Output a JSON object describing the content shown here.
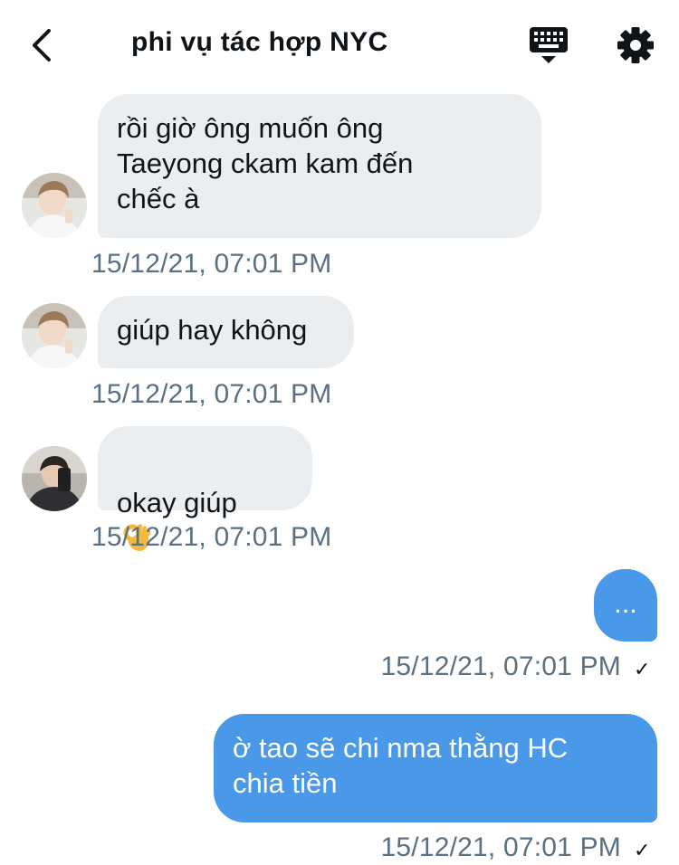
{
  "header": {
    "title": "phi vụ tác hợp NYC",
    "icons": [
      "back-arrow-icon",
      "keyboard-icon",
      "gear-icon"
    ]
  },
  "messages": [
    {
      "direction": "incoming",
      "text": "rồi giờ ông muốn ông\nTaeyong ckam kam đến\nchếc à",
      "timestamp": "15/12/21, 07:01 PM",
      "avatar": "avatar-white-hoodie"
    },
    {
      "direction": "incoming",
      "text": "giúp hay không",
      "timestamp": "15/12/21, 07:01 PM",
      "avatar": "avatar-white-hoodie"
    },
    {
      "direction": "incoming",
      "text": "okay giúp",
      "emoji": "ok-hand-emoji",
      "timestamp": "15/12/21, 07:01 PM",
      "avatar": "avatar-dark-jacket"
    },
    {
      "direction": "outgoing",
      "text": "...",
      "timestamp": "15/12/21, 07:01 PM",
      "status": "✓"
    },
    {
      "direction": "outgoing",
      "text": "ờ tao sẽ chi nma thằng HC\nchia tiền",
      "timestamp": "15/12/21, 07:01 PM",
      "status": "✓"
    }
  ],
  "colors": {
    "incoming_bubble": "#ebeef0",
    "outgoing_bubble": "#4a99e9",
    "timestamp": "#5b7083",
    "text": "#0f1419"
  }
}
